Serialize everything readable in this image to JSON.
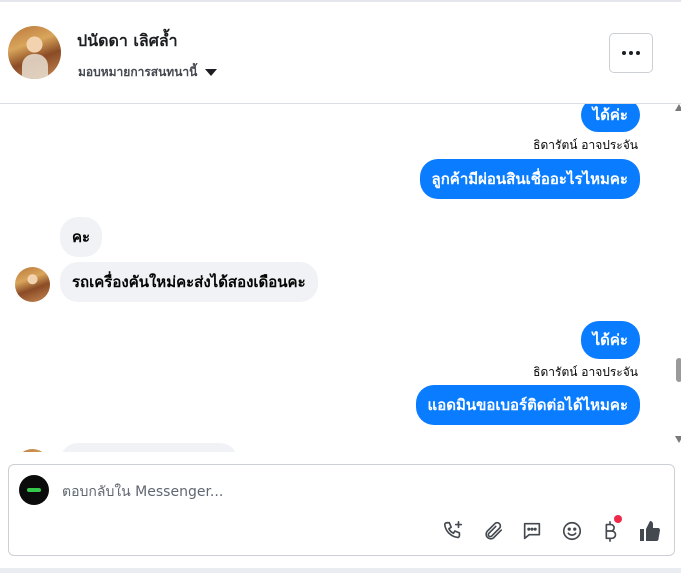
{
  "header": {
    "contact_name": "ปนัดดา เลิศล้ำ",
    "assign_label": "มอบหมายการสนทนานี้"
  },
  "messages": [
    {
      "direction": "out",
      "text": "ได้ค่ะ"
    },
    {
      "direction": "sender",
      "text": "ธิดารัตน์ อาจประจัน"
    },
    {
      "direction": "out",
      "text": "ลูกค้ามีผ่อนสินเชื่ออะไรไหมคะ"
    },
    {
      "direction": "in",
      "text": "คะ"
    },
    {
      "direction": "in",
      "text": "รถเครื่องคันใหม่คะส่งได้สองเดือนคะ"
    },
    {
      "direction": "out",
      "text": "ได้ค่ะ"
    },
    {
      "direction": "sender",
      "text": "ธิดารัตน์ อาจประจัน"
    },
    {
      "direction": "out",
      "text": "แอดมินขอเบอร์ติดต่อได้ไหมคะ"
    }
  ],
  "composer": {
    "placeholder": "ตอบกลับใน Messenger...",
    "tools": [
      "call-add-icon",
      "attach-icon",
      "saved-reply-icon",
      "emoji-icon",
      "baht-icon",
      "like-icon"
    ]
  },
  "colors": {
    "outgoing_bubble": "#0a7cff",
    "incoming_bubble": "#f0f2f5",
    "badge": "#f02849"
  }
}
